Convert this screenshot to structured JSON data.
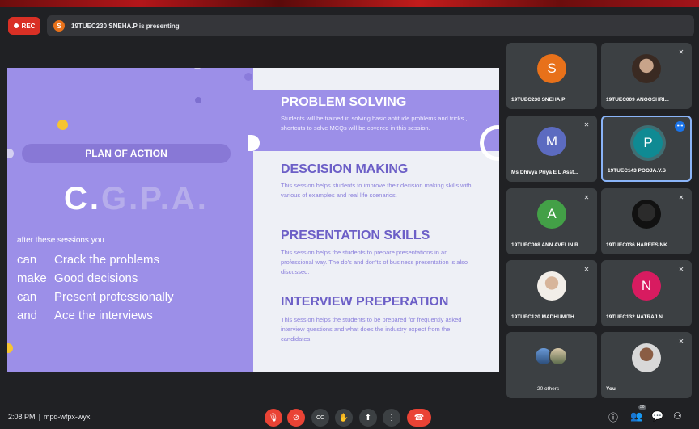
{
  "rec": {
    "label": "REC"
  },
  "presenting": {
    "initial": "S",
    "text": "19TUEC230 SNEHA.P is presenting"
  },
  "slide": {
    "left": {
      "plan": "PLAN OF ACTION",
      "cgpa_c": "C.",
      "cgpa_rest": "G.P.A.",
      "after": "after these sessions you",
      "lines": [
        {
          "w1": "can",
          "rest": "Crack  the problems"
        },
        {
          "w1": "make",
          "rest": "Good decisions"
        },
        {
          "w1": "can",
          "rest": "Present professionally"
        },
        {
          "w1": "and",
          "rest": "Ace the interviews"
        }
      ]
    },
    "sections": [
      {
        "title": "PROBLEM SOLVING",
        "desc": "Students will be trained in solving basic aptitude problems and tricks , shortcuts to solve MCQs will be covered in this session."
      },
      {
        "title": "DESCISION MAKING",
        "desc": "This session helps students to improve their decision making skills with various of examples and real life scenarios."
      },
      {
        "title": "PRESENTATION SKILLS",
        "desc": "This session helps the students to prepare presentations in an professional way. The  do's and don'ts of business presentation is also discussed."
      },
      {
        "title": "INTERVIEW PREPERATION",
        "desc": "This session helps the students to be prepared for frequently asked interview questions and what does the industry expect from the candidates."
      }
    ],
    "colors": {
      "purple": "#9c8fe8",
      "title": "#6c5fc7",
      "desc": "#8b80dc"
    }
  },
  "participants": [
    {
      "name": "19TUEC230 SNEHA.P",
      "initial": "S",
      "color": "#e8711a",
      "avatar": "letter"
    },
    {
      "name": "19TUEC009 ANOOSHRI...",
      "initial": "",
      "color": "",
      "avatar": "photo"
    },
    {
      "name": "Ms Dhivya Priya E L Asst...",
      "initial": "M",
      "color": "#5c6bc0",
      "avatar": "letter"
    },
    {
      "name": "19TUEC143 POOJA.V.S",
      "initial": "P",
      "color": "#0f8a93",
      "avatar": "letter"
    },
    {
      "name": "19TUEC008 ANN AVELIN.R",
      "initial": "A",
      "color": "#43a047",
      "avatar": "letter"
    },
    {
      "name": "19TUEC036 HAREES.NK",
      "initial": "",
      "color": "",
      "avatar": "photo"
    },
    {
      "name": "19TUEC120 MADHUMITH...",
      "initial": "",
      "color": "",
      "avatar": "photo"
    },
    {
      "name": "19TUEC132 NATRAJ.N",
      "initial": "N",
      "color": "#d81b60",
      "avatar": "letter"
    },
    {
      "name": "20 others",
      "initial": "",
      "color": "",
      "avatar": "group"
    },
    {
      "name": "You",
      "initial": "",
      "color": "",
      "avatar": "photo"
    }
  ],
  "bottom": {
    "time": "2:08 PM",
    "meeting_code": "mpq-wfpx-wyx",
    "people_count": "30"
  }
}
